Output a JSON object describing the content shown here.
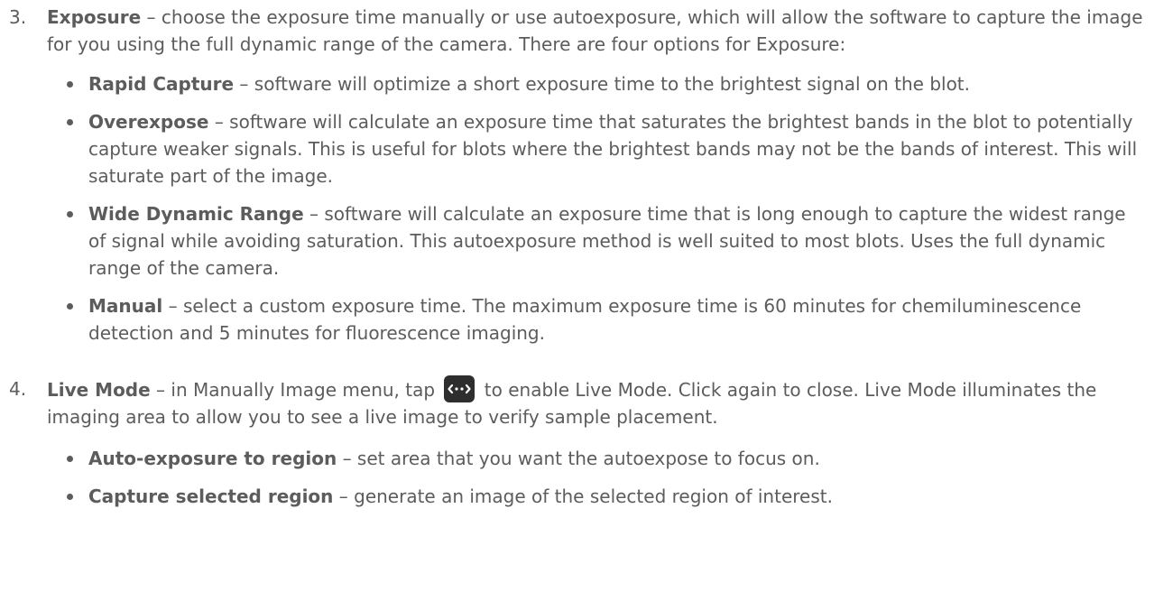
{
  "step3": {
    "number": "3.",
    "term": "Exposure",
    "text": " – choose the exposure time manually or use autoexposure, which will allow the software to capture the image for you using the full dynamic range of the camera. There are four options for Exposure:",
    "bullets": [
      {
        "term": "Rapid Capture",
        "text": " – software will optimize a short exposure time to the brightest signal on the blot."
      },
      {
        "term": "Overexpose",
        "text": " – software will calculate an exposure time that saturates the brightest bands in the blot to potentially capture weaker signals. This is useful for blots where the brightest bands may not be the bands of interest. This will saturate part of the image."
      },
      {
        "term": "Wide Dynamic Range",
        "text": " – software will calculate an exposure time that is long enough to capture the widest range of signal while avoiding saturation. This autoexposure method is well suited to most blots. Uses the full dynamic range of the camera."
      },
      {
        "term": "Manual",
        "text": " – select a custom exposure time. The maximum exposure time is 60 minutes for chemiluminescence detection and 5 minutes for fluorescence imaging."
      }
    ]
  },
  "step4": {
    "number": "4.",
    "term": "Live Mode",
    "text_before_icon": " – in Manually Image menu, tap ",
    "icon": "live-mode-icon",
    "text_after_icon": " to enable Live Mode. Click again to close. Live Mode illuminates the imaging area to allow you to see a live image to verify sample placement.",
    "bullets": [
      {
        "term": "Auto-exposure to region",
        "text": " – set area that you want the autoexpose to focus on."
      },
      {
        "term": "Capture selected region",
        "text": " – generate an image of the selected region of interest."
      }
    ]
  },
  "colors": {
    "text": "#5c5c5c",
    "icon_background": "#2e2e2e",
    "icon_glyph": "#ffffff"
  }
}
